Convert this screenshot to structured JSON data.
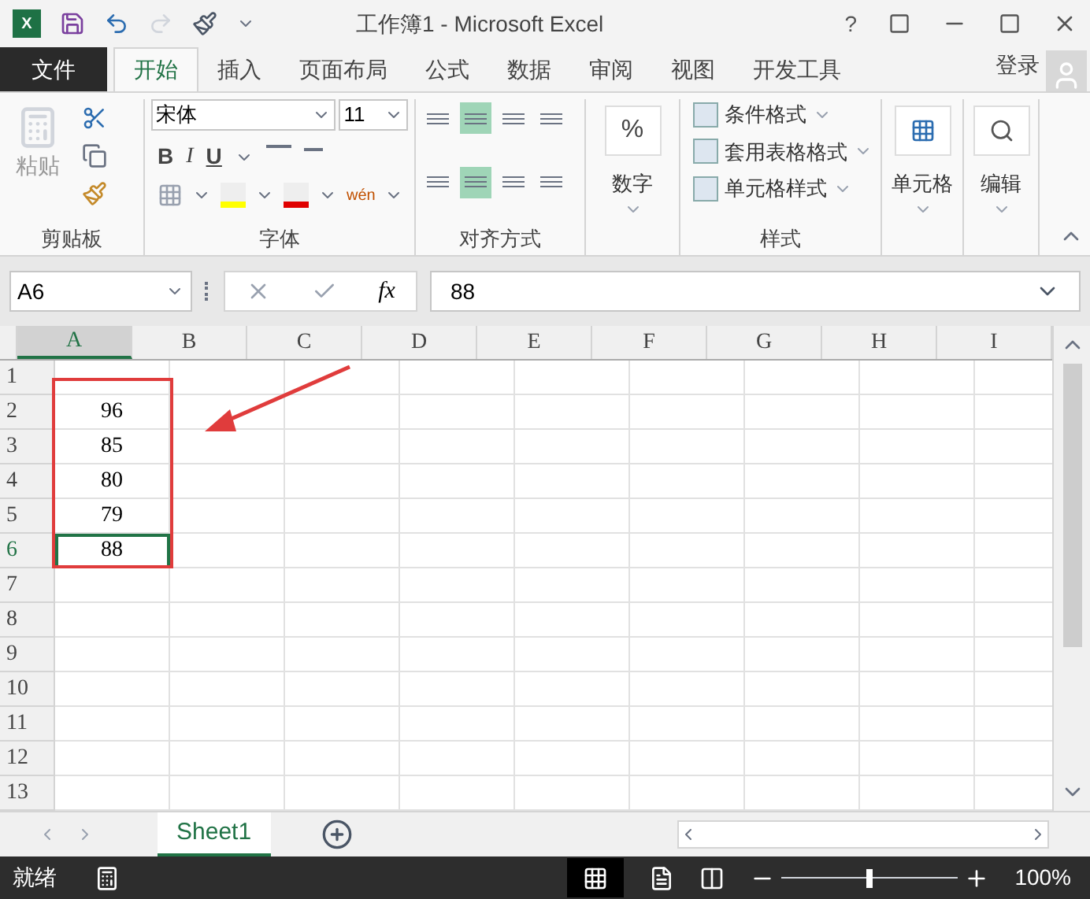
{
  "window": {
    "app_icon": "X",
    "title": "工作簿1 - Microsoft Excel",
    "help": "?"
  },
  "file_tab": "文件",
  "tabs": [
    {
      "label": "开始",
      "selected": true
    },
    {
      "label": "插入",
      "selected": false
    },
    {
      "label": "页面布局",
      "selected": false
    },
    {
      "label": "公式",
      "selected": false
    },
    {
      "label": "数据",
      "selected": false
    },
    {
      "label": "审阅",
      "selected": false
    },
    {
      "label": "视图",
      "selected": false
    },
    {
      "label": "开发工具",
      "selected": false
    }
  ],
  "sign_in": "登录",
  "ribbon": {
    "clipboard": {
      "paste": "粘贴",
      "label": "剪贴板"
    },
    "font": {
      "font_name": "宋体",
      "font_size": "11",
      "bold": "B",
      "italic": "I",
      "underline": "U",
      "phonetic": "wén",
      "label": "字体"
    },
    "alignment": {
      "label": "对齐方式"
    },
    "number": {
      "symbol": "%",
      "label": "数字"
    },
    "styles": {
      "items": [
        "条件格式",
        "套用表格格式",
        "单元格样式"
      ],
      "label": "样式"
    },
    "cells": {
      "label": "单元格"
    },
    "editing": {
      "label": "编辑"
    }
  },
  "formula_bar": {
    "name_box": "A6",
    "fx": "fx",
    "value": "88"
  },
  "columns": [
    {
      "label": "A",
      "selected": true
    },
    {
      "label": "B",
      "selected": false
    },
    {
      "label": "C",
      "selected": false
    },
    {
      "label": "D",
      "selected": false
    },
    {
      "label": "E",
      "selected": false
    },
    {
      "label": "F",
      "selected": false
    },
    {
      "label": "G",
      "selected": false
    },
    {
      "label": "H",
      "selected": false
    },
    {
      "label": "I",
      "selected": false
    }
  ],
  "rows": [
    {
      "number": "1",
      "selected": false
    },
    {
      "number": "2",
      "selected": false,
      "a": "96"
    },
    {
      "number": "3",
      "selected": false,
      "a": "85"
    },
    {
      "number": "4",
      "selected": false,
      "a": "80"
    },
    {
      "number": "5",
      "selected": false,
      "a": "79"
    },
    {
      "number": "6",
      "selected": true,
      "a": "88"
    },
    {
      "number": "7",
      "selected": false
    },
    {
      "number": "8",
      "selected": false
    },
    {
      "number": "9",
      "selected": false
    },
    {
      "number": "10",
      "selected": false
    },
    {
      "number": "11",
      "selected": false
    },
    {
      "number": "12",
      "selected": false
    },
    {
      "number": "13",
      "selected": false
    }
  ],
  "sheet_tabs": [
    {
      "label": "Sheet1",
      "selected": true
    }
  ],
  "status_bar": {
    "status": "就绪",
    "zoom": "100%",
    "zoom_slider": {
      "level": 0.5
    }
  }
}
